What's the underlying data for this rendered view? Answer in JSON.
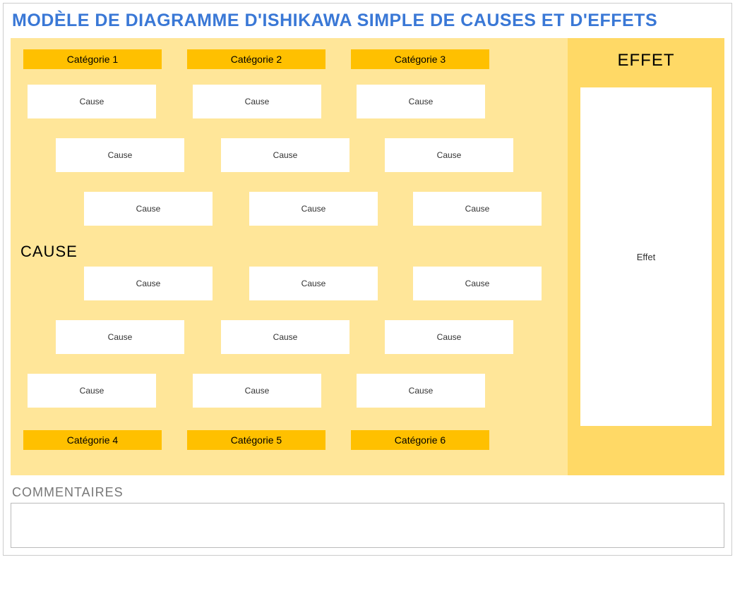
{
  "title": "MODÈLE DE DIAGRAMME D'ISHIKAWA SIMPLE DE CAUSES ET D'EFFETS",
  "cause_heading": "CAUSE",
  "effect_heading": "EFFET",
  "effect_value": "Effet",
  "categories_top": [
    "Catégorie 1",
    "Catégorie 2",
    "Catégorie 3"
  ],
  "categories_bottom": [
    "Catégorie 4",
    "Catégorie 5",
    "Catégorie 6"
  ],
  "causes": {
    "col1": [
      "Cause",
      "Cause",
      "Cause",
      "Cause",
      "Cause",
      "Cause"
    ],
    "col2": [
      "Cause",
      "Cause",
      "Cause",
      "Cause",
      "Cause",
      "Cause"
    ],
    "col3": [
      "Cause",
      "Cause",
      "Cause",
      "Cause",
      "Cause",
      "Cause"
    ]
  },
  "comments_label": "COMMENTAIRES",
  "comments_value": ""
}
